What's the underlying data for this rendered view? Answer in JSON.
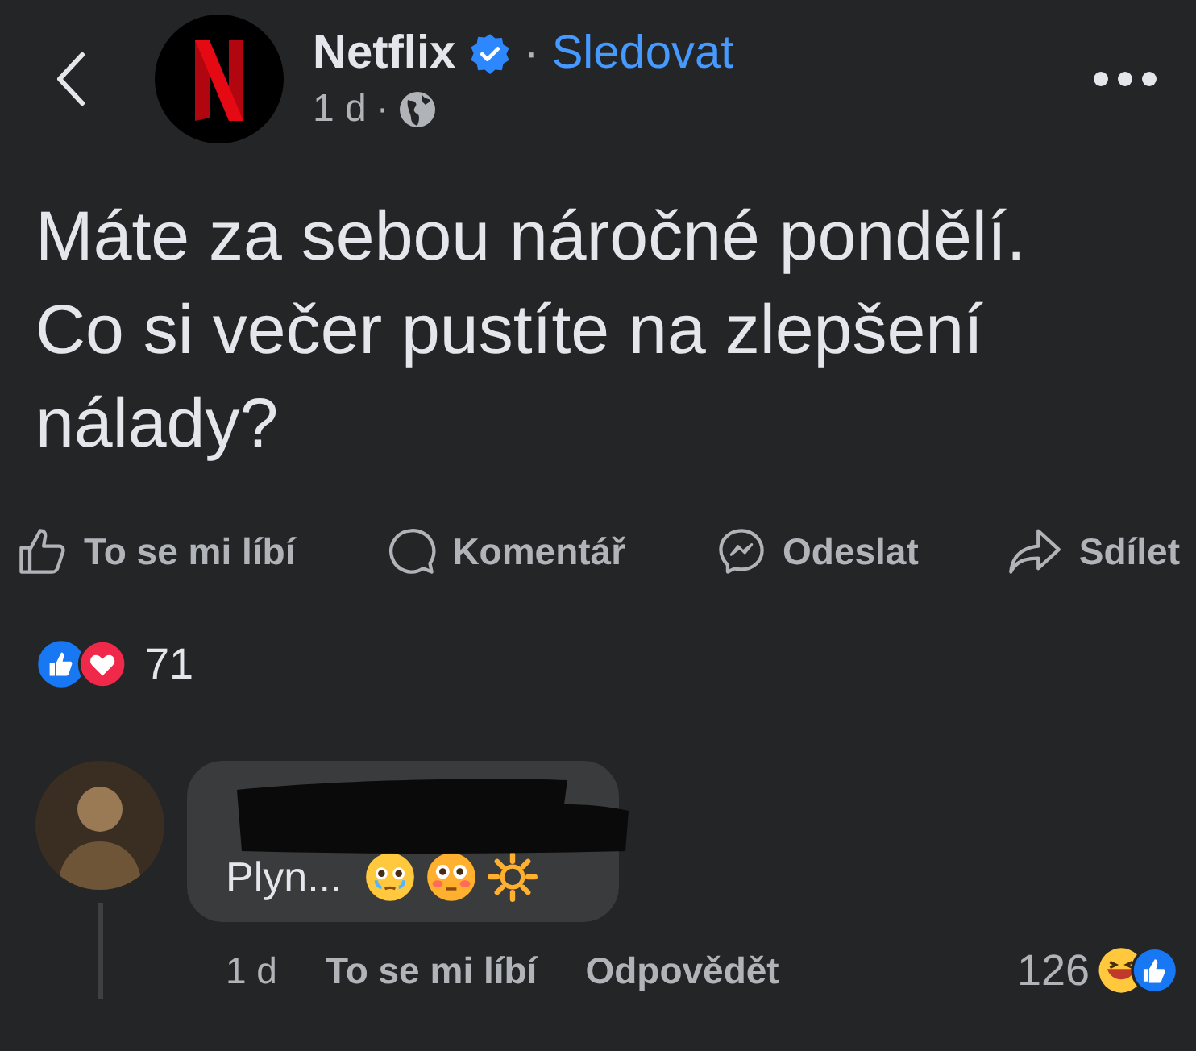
{
  "post": {
    "author": "Netflix",
    "verified": true,
    "follow_label": "Sledovat",
    "time": "1 d",
    "separator": "·",
    "body": "Máte za sebou náročné pondělí. Co si večer pustíte na zlepšení nálady?"
  },
  "actions": [
    {
      "kind": "like",
      "label": "To se mi líbí"
    },
    {
      "kind": "comment",
      "label": "Komentář"
    },
    {
      "kind": "send",
      "label": "Odeslat"
    },
    {
      "kind": "share",
      "label": "Sdílet"
    }
  ],
  "reactions": {
    "count": "71"
  },
  "comment": {
    "redacted_name": true,
    "text": "Plyn...",
    "time": "1 d",
    "like_label": "To se mi líbí",
    "reply_label": "Odpovědět",
    "reaction_count": "126"
  }
}
